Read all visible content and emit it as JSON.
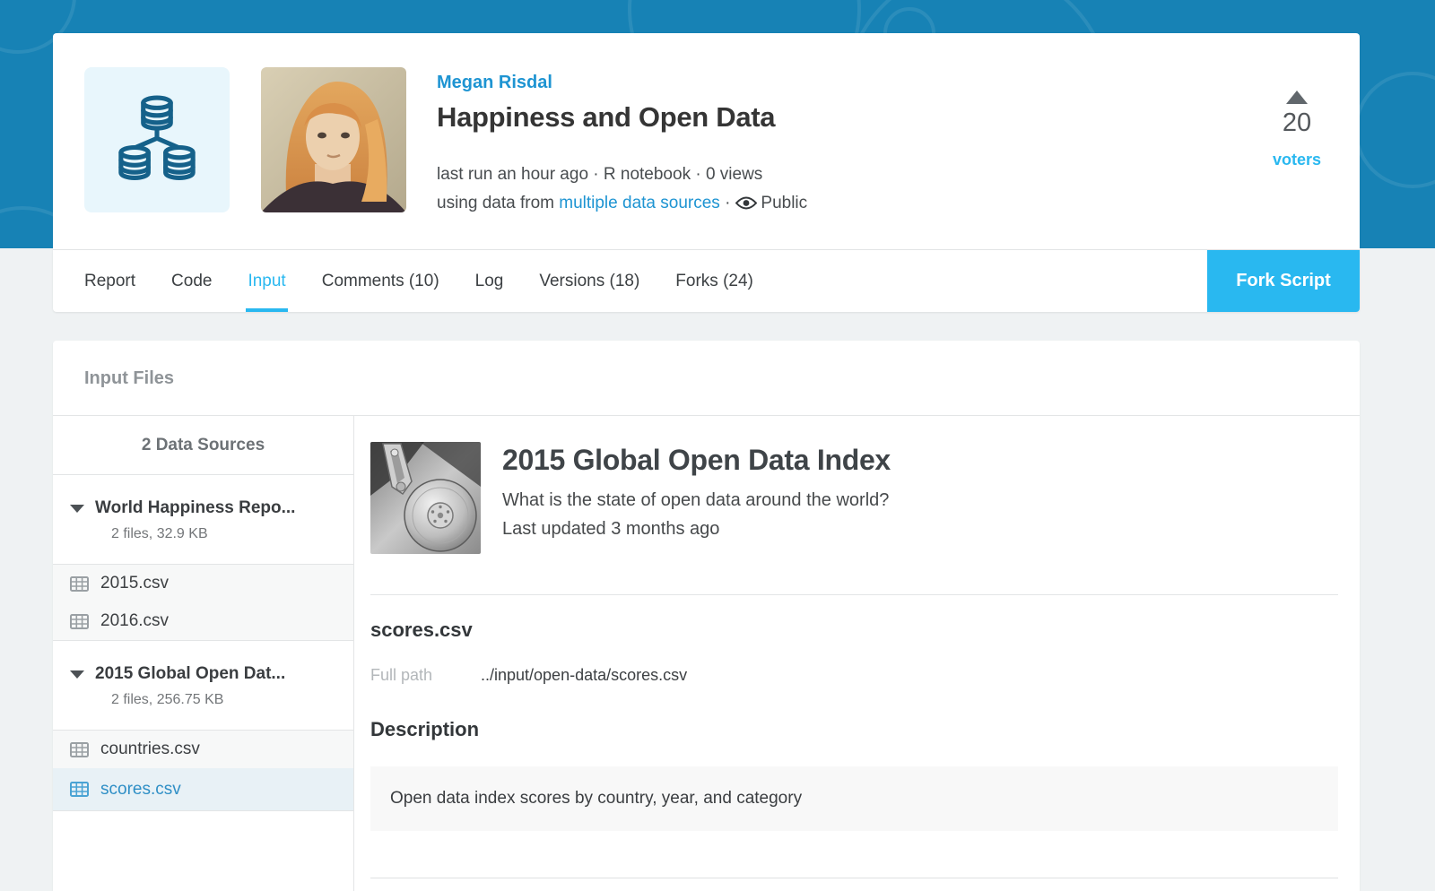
{
  "header": {
    "author": "Megan Risdal",
    "title": "Happiness and Open Data",
    "meta_line1": "last run an hour ago · R notebook · 0 views",
    "meta2_prefix": "using data from",
    "meta2_link": "multiple data sources",
    "meta2_sep": "·",
    "visibility": "Public",
    "vote_count": "20",
    "voters_label": "voters"
  },
  "tabs": [
    {
      "label": "Report",
      "active": false
    },
    {
      "label": "Code",
      "active": false
    },
    {
      "label": "Input",
      "active": true
    },
    {
      "label": "Comments (10)",
      "active": false
    },
    {
      "label": "Log",
      "active": false
    },
    {
      "label": "Versions (18)",
      "active": false
    },
    {
      "label": "Forks (24)",
      "active": false
    }
  ],
  "fork_button_label": "Fork Script",
  "input_files": {
    "title": "Input Files",
    "sources_count": "2 Data Sources",
    "sources": [
      {
        "name": "World Happiness Repo...",
        "meta": "2 files, 32.9 KB",
        "files": [
          {
            "name": "2015.csv",
            "selected": false
          },
          {
            "name": "2016.csv",
            "selected": false
          }
        ]
      },
      {
        "name": "2015 Global Open Dat...",
        "meta": "2 files, 256.75 KB",
        "files": [
          {
            "name": "countries.csv",
            "selected": false
          },
          {
            "name": "scores.csv",
            "selected": true
          }
        ]
      }
    ]
  },
  "dataset": {
    "title": "2015 Global Open Data Index",
    "subtitle": "What is the state of open data around the world?",
    "updated": "Last updated 3 months ago"
  },
  "file_detail": {
    "name": "scores.csv",
    "full_path_label": "Full path",
    "full_path": "../input/open-data/scores.csv",
    "description_label": "Description",
    "description": "Open data index scores by country, year, and category"
  },
  "colors": {
    "header_blue": "#1782b5",
    "accent_cyan": "#29b8f0",
    "link_blue": "#1e94d2",
    "selected_row_bg": "#e8f1f6",
    "db_icon_stroke": "#15618a"
  }
}
